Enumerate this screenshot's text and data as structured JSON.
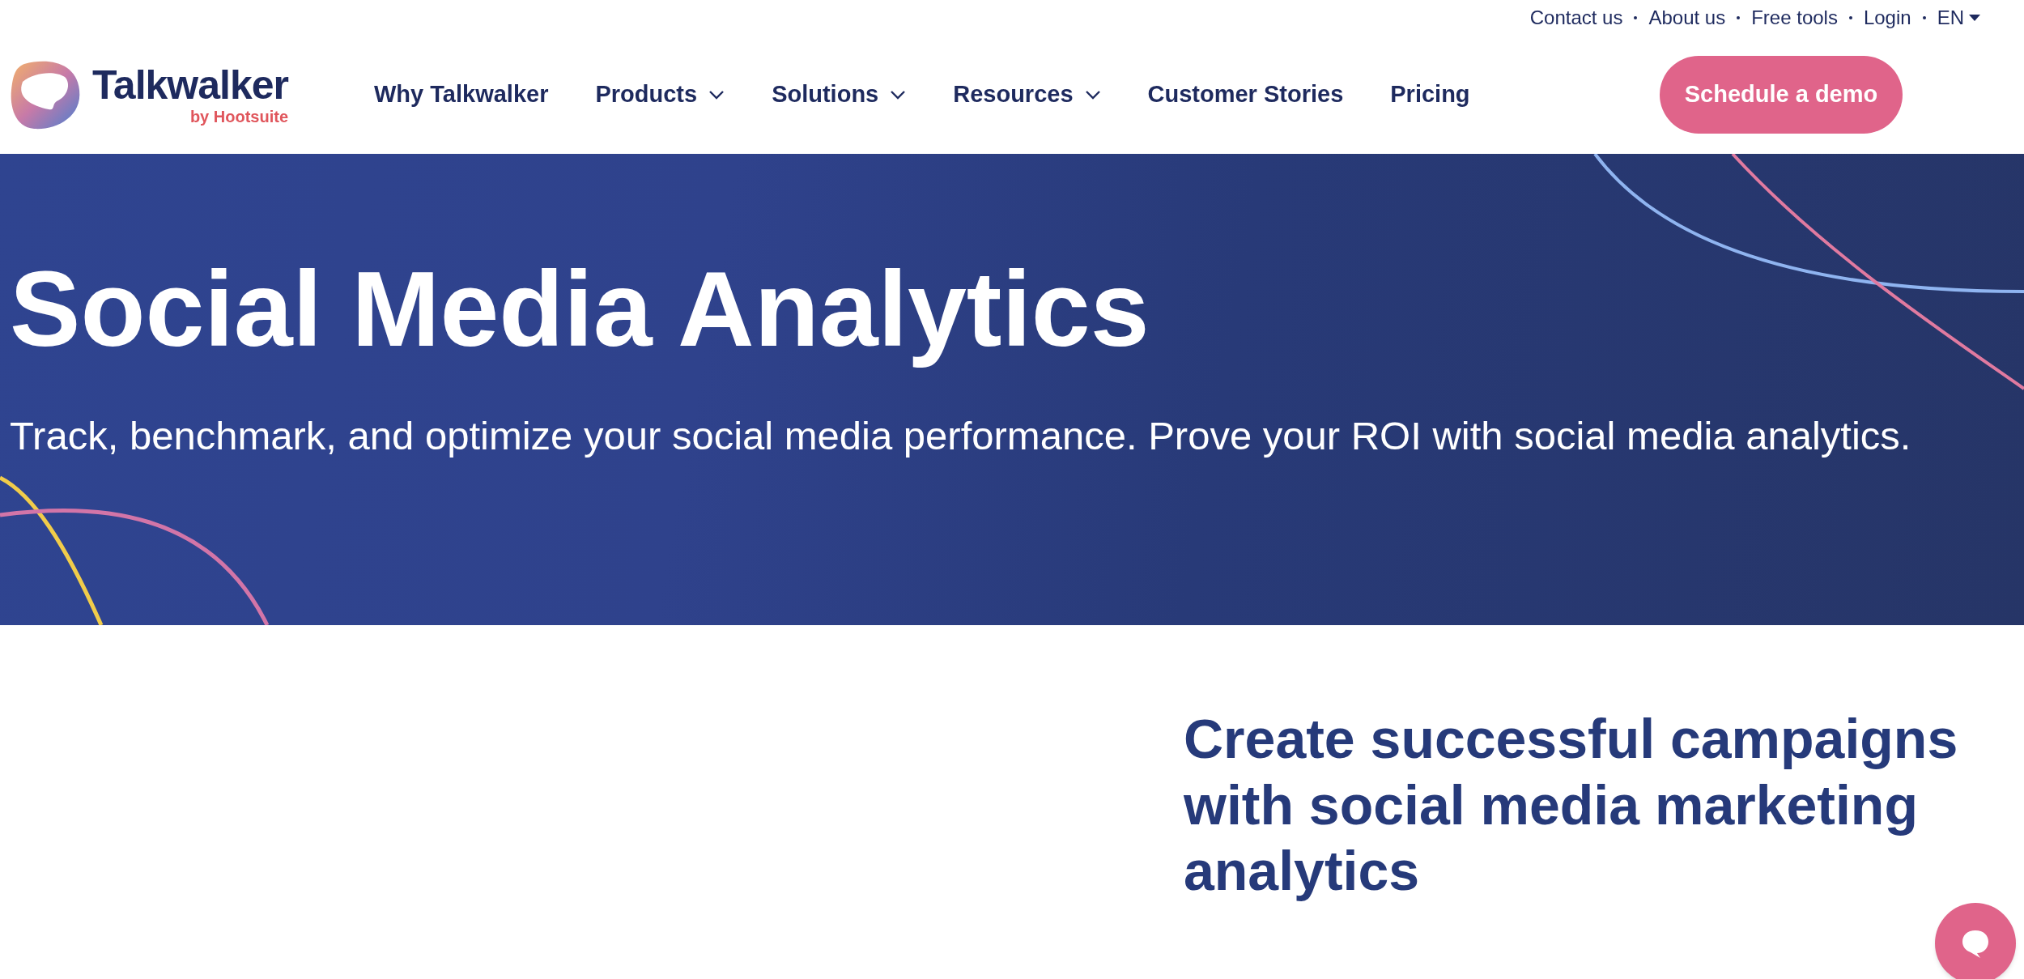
{
  "top_links": [
    {
      "label": "Contact us"
    },
    {
      "label": "About us"
    },
    {
      "label": "Free tools"
    },
    {
      "label": "Login"
    },
    {
      "label": "EN",
      "has_menu": true
    }
  ],
  "logo": {
    "name": "Talkwalker",
    "tagline": "by Hootsuite"
  },
  "nav": [
    {
      "label": "Why Talkwalker",
      "has_menu": false
    },
    {
      "label": "Products",
      "has_menu": true
    },
    {
      "label": "Solutions",
      "has_menu": true
    },
    {
      "label": "Resources",
      "has_menu": true
    },
    {
      "label": "Customer Stories",
      "has_menu": false
    },
    {
      "label": "Pricing",
      "has_menu": false
    }
  ],
  "cta": "Schedule a demo",
  "hero": {
    "title": "Social Media Analytics",
    "subtitle": "Track, benchmark, and optimize your social media performance. Prove your ROI with social media analytics."
  },
  "section": {
    "heading": "Create successful campaigns with social media marketing analytics"
  }
}
